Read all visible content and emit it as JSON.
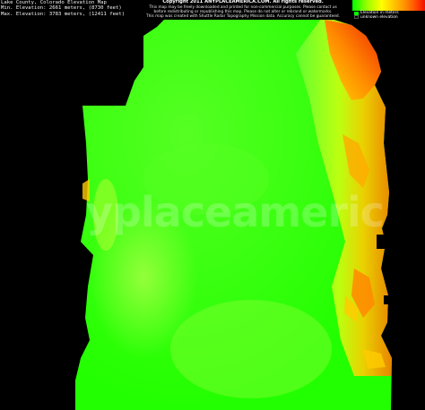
{
  "header": {
    "title": "Lake County, Colorado Elevation Map",
    "min_elevation": "Min. Elevation: 2661 meters, (8730 feet)",
    "max_elevation": "Max. Elevation: 3783 meters, (12411 feet)"
  },
  "notice": {
    "copyright": "Copyright 2011 ANYPLACEAMERICA.COM.  All rights reserved.",
    "line1": "This map may be freely downloaded and printed for non-commercial purposes.  Please contact us",
    "line2": "before redistributing or republishing this map.  Please do not alter or rebrand or watermarks.",
    "line3": "This map was created with Shuttle Radar Topography Mission data.  Accuracy cannot be guaranteed."
  },
  "legend": {
    "elevation_label": "Elevation in meters",
    "unknown_label": "unknown elevation",
    "elevation_swatch_color": "#00ff00",
    "unknown_swatch_color": "#000000"
  },
  "map": {
    "watermark": "yplaceamerica.com",
    "colors": {
      "low": "#00ff00",
      "mid": "#99ff33",
      "high": "#ffcc00",
      "peak": "#ee1100",
      "background": "#000000"
    }
  }
}
